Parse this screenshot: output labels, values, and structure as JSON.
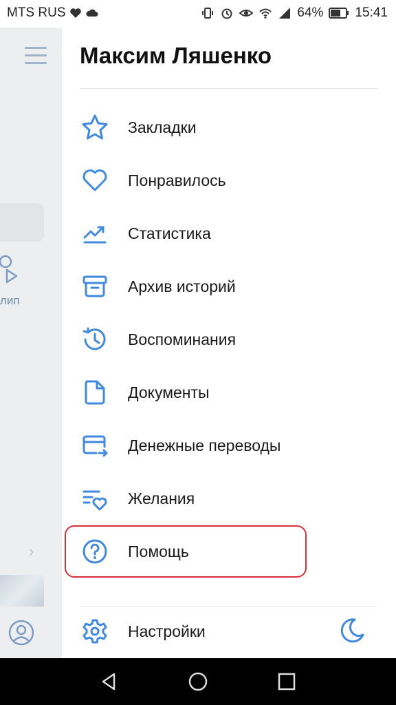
{
  "status_bar": {
    "carrier": "MTS RUS",
    "battery": "64%",
    "time": "15:41"
  },
  "background_app": {
    "clip_label": "лип"
  },
  "drawer": {
    "profile_name": "Максим Ляшенко",
    "menu_items": [
      {
        "label": "Закладки",
        "icon": "star-icon"
      },
      {
        "label": "Понравилось",
        "icon": "heart-icon"
      },
      {
        "label": "Статистика",
        "icon": "trend-chart-icon"
      },
      {
        "label": "Архив историй",
        "icon": "archive-icon"
      },
      {
        "label": "Воспоминания",
        "icon": "history-icon"
      },
      {
        "label": "Документы",
        "icon": "document-icon"
      },
      {
        "label": "Денежные переводы",
        "icon": "money-transfer-icon"
      },
      {
        "label": "Желания",
        "icon": "wishlist-icon"
      },
      {
        "label": "Помощь",
        "icon": "help-icon"
      }
    ],
    "settings_label": "Настройки"
  },
  "colors": {
    "accent": "#3f8ae0",
    "highlight": "#d9303a"
  }
}
